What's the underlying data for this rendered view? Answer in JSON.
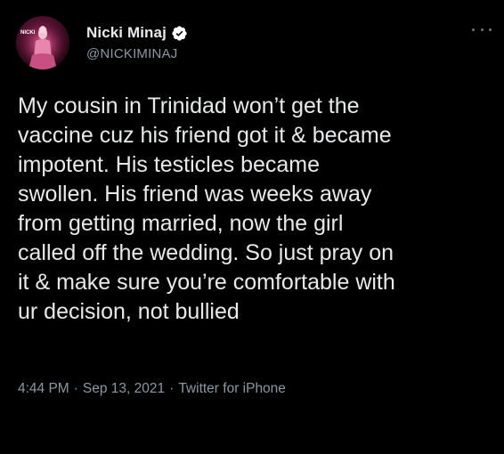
{
  "author": {
    "display_name": "Nicki Minaj",
    "handle": "@NICKIMINAJ",
    "verified": true,
    "avatar_icon": "profile-photo",
    "avatar_overlay_text": "NICKI"
  },
  "menu": {
    "icon": "more-horizontal-icon"
  },
  "tweet": {
    "lines": [
      "My cousin in Trinidad won’t get the",
      "vaccine cuz his friend got it & became",
      "impotent. His testicles became",
      "swollen. His friend was weeks away",
      "from getting married, now the girl",
      "called off the wedding. So just pray on",
      "it & make sure you’re comfortable with",
      "ur decision, not bullied"
    ]
  },
  "meta": {
    "time": "4:44 PM",
    "separator": "·",
    "date": "Sep 13, 2021",
    "source": "Twitter for iPhone"
  },
  "colors": {
    "background": "#000000",
    "text_primary": "#e7e9ea",
    "text_secondary": "#8b98a5",
    "verified_badge": "#ffffff"
  }
}
